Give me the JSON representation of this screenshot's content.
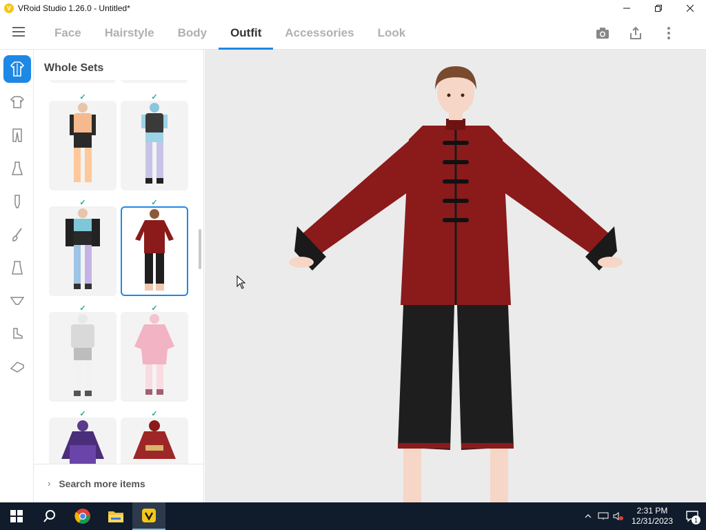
{
  "window": {
    "title": "VRoid Studio 1.26.0 - Untitled*",
    "controls": [
      "minimize",
      "maximize",
      "close"
    ]
  },
  "nav": {
    "tabs": [
      {
        "label": "Face",
        "active": false
      },
      {
        "label": "Hairstyle",
        "active": false
      },
      {
        "label": "Body",
        "active": false
      },
      {
        "label": "Outfit",
        "active": true
      },
      {
        "label": "Accessories",
        "active": false
      },
      {
        "label": "Look",
        "active": false
      }
    ],
    "actions": [
      "camera-icon",
      "share-icon",
      "more-vert-icon"
    ]
  },
  "rail": {
    "items": [
      {
        "icon": "whole-set-icon",
        "active": true
      },
      {
        "icon": "tops-icon",
        "active": false
      },
      {
        "icon": "bottoms-icon",
        "active": false
      },
      {
        "icon": "onepiece-icon",
        "active": false
      },
      {
        "icon": "socks-icon",
        "active": false
      },
      {
        "icon": "brush-icon",
        "active": false
      },
      {
        "icon": "skirt-icon",
        "active": false
      },
      {
        "icon": "underwear-icon",
        "active": false
      },
      {
        "icon": "shoes-icon",
        "active": false
      },
      {
        "icon": "tag-icon",
        "active": false
      }
    ]
  },
  "panel": {
    "title": "Whole Sets",
    "search_more": "Search more items",
    "items": [
      {
        "name": "partial-set-a",
        "checked": false,
        "selected": false
      },
      {
        "name": "partial-set-b",
        "checked": false,
        "selected": false
      },
      {
        "name": "orange-black-set",
        "checked": true,
        "selected": false
      },
      {
        "name": "blue-black-set",
        "checked": true,
        "selected": false
      },
      {
        "name": "black-blue-sleeves-set",
        "checked": true,
        "selected": false
      },
      {
        "name": "red-chinese-jacket-set",
        "checked": true,
        "selected": true
      },
      {
        "name": "white-grey-set",
        "checked": true,
        "selected": false
      },
      {
        "name": "pink-kimono-set",
        "checked": true,
        "selected": false
      },
      {
        "name": "purple-dress-set",
        "checked": true,
        "selected": false
      },
      {
        "name": "red-dress-set",
        "checked": true,
        "selected": false
      }
    ],
    "check_glyph": "✓"
  },
  "taskbar": {
    "apps": [
      "windows-start-icon",
      "search-icon",
      "chrome-icon",
      "file-explorer-icon",
      "vroid-studio-icon"
    ],
    "active_app": "vroid-studio-icon",
    "time": "2:31 PM",
    "date": "12/31/2023",
    "notification_count": "1"
  },
  "colors": {
    "accent": "#1e88e5",
    "check": "#26a69a",
    "jacket": "#8b1a1a",
    "taskbar": "#101b2b"
  }
}
